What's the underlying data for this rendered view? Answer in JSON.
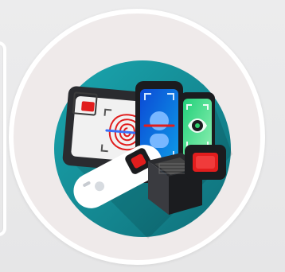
{
  "theme": {
    "background": "#e9e9ea",
    "ring": "#ffffff",
    "plate": "#efeaea",
    "teal": "#1aa7b0",
    "teal_dark": "#0f6f79",
    "accent_red": "#e02b2b",
    "accent_blue": "#3a6ff7",
    "accent_green": "#2ecf6a"
  },
  "icons": [
    "left-card-outline",
    "fingerprint-scanner-tablet-icon",
    "face-recognition-phone-icon",
    "iris-scan-phone-icon",
    "handheld-scanner-icon",
    "desktop-fingerprint-reader-icon",
    "fingerprint-reader-icon"
  ]
}
